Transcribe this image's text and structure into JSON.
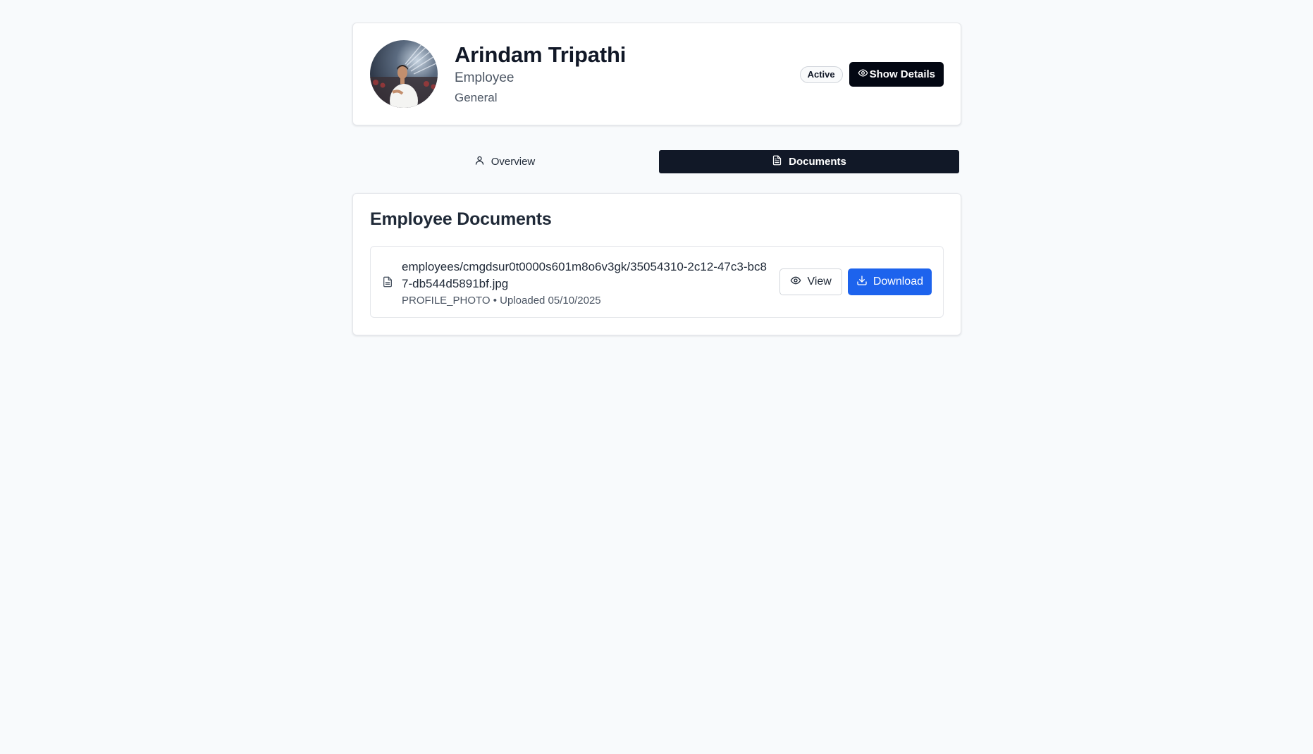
{
  "profile": {
    "name": "Arindam Tripathi",
    "role": "Employee",
    "department": "General",
    "status_badge": "Active",
    "show_details_label": "Show Details"
  },
  "tabs": [
    {
      "label": "Overview",
      "icon": "user-icon",
      "active": false
    },
    {
      "label": "Documents",
      "icon": "file-text-icon",
      "active": true
    }
  ],
  "documents": {
    "title": "Employee Documents",
    "items": [
      {
        "name": "employees/cmgdsur0t0000s601m8o6v3gk/35054310-2c12-47c3-bc87-db544d5891bf.jpg",
        "meta": "PROFILE_PHOTO • Uploaded 05/10/2025",
        "view_label": "View",
        "download_label": "Download"
      }
    ]
  },
  "colors": {
    "page_bg": "#f8fafc",
    "dark_button": "#030712",
    "active_tab": "#111827",
    "download_button": "#1d63ed"
  }
}
